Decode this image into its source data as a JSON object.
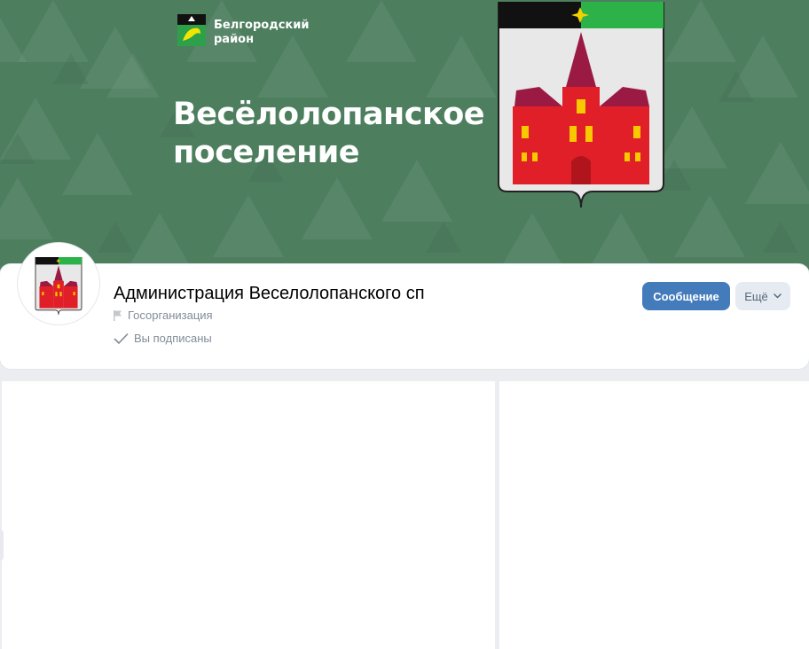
{
  "cover": {
    "region_line1": "Белгородский",
    "region_line2": "район",
    "title_line1": "Весёлолопанское",
    "title_line2": "поселение",
    "background_color": "#4d7f5f"
  },
  "header": {
    "group_name": "Администрация Веселолопанского сп",
    "group_type": "Госорганизация",
    "subscription_status": "Вы подписаны",
    "message_button": "Сообщение",
    "more_button": "Ещё",
    "accent_color": "#447bba"
  },
  "icons": {
    "avatar": "coat-of-arms",
    "type": "flag-icon",
    "subscribed": "checkmark-icon",
    "more": "chevron-down-icon"
  }
}
